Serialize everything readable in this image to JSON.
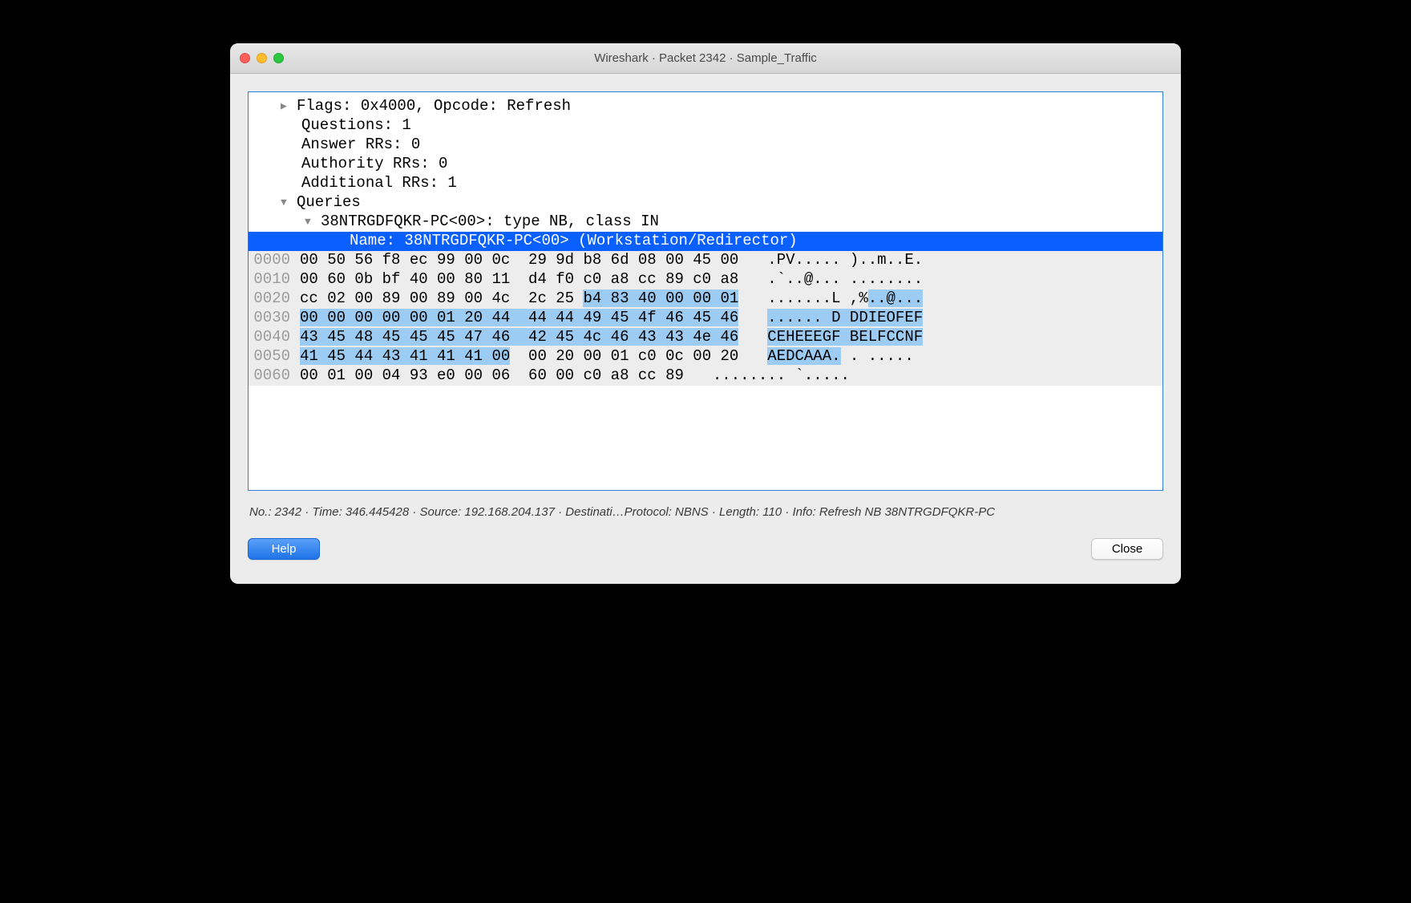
{
  "window": {
    "title": "Wireshark · Packet 2342 · Sample_Traffic"
  },
  "tree": {
    "flags": "Flags: 0x4000, Opcode: Refresh",
    "questions": "Questions: 1",
    "answer": "Answer RRs: 0",
    "authority": "Authority RRs: 0",
    "additional": "Additional RRs: 1",
    "queries": "Queries",
    "query_item": "38NTRGDFQKR-PC<00>: type NB, class IN",
    "name_line": "Name: 38NTRGDFQKR-PC<00> (Workstation/Redirector)"
  },
  "hex": {
    "rows": [
      {
        "offset": "0000",
        "p": "00 50 56 f8 ec 99 00 0c  29 9d b8 6d 08 00 45 00",
        "h": "",
        "a_p": ".PV..... )..m..E.",
        "a_h": ""
      },
      {
        "offset": "0010",
        "p": "00 60 0b bf 40 00 80 11  d4 f0 c0 a8 cc 89 c0 a8",
        "h": "",
        "a_p": ".`..@... ........",
        "a_h": ""
      },
      {
        "offset": "0020",
        "p": "cc 02 00 89 00 89 00 4c  2c 25 ",
        "h": "b4 83 40 00 00 01",
        "a_p": ".......L ,%",
        "a_h": "..@..."
      },
      {
        "offset": "0030",
        "p": "",
        "h": "00 00 00 00 00 01 20 44  44 44 49 45 4f 46 45 46",
        "a_p": "",
        "a_h": "...... D DDIEOFEF"
      },
      {
        "offset": "0040",
        "p": "",
        "h": "43 45 48 45 45 45 47 46  42 45 4c 46 43 43 4e 46",
        "a_p": "",
        "a_h": "CEHEEEGF BELFCCNF"
      },
      {
        "offset": "0050",
        "p": "",
        "h": "41 45 44 43 41 41 41 00",
        "p2": "  00 20 00 01 c0 0c 00 20",
        "a_h": "AEDCAAA.",
        "a_p2": " . ..... "
      },
      {
        "offset": "0060",
        "p": "00 01 00 04 93 e0 00 06  60 00 c0 a8 cc 89",
        "h": "",
        "a_p": "........ `.....",
        "a_h": ""
      }
    ]
  },
  "status": "No.: 2342 · Time: 346.445428 · Source: 192.168.204.137 · Destinati…Protocol: NBNS · Length: 110 · Info: Refresh NB 38NTRGDFQKR-PC",
  "buttons": {
    "help": "Help",
    "close": "Close"
  }
}
